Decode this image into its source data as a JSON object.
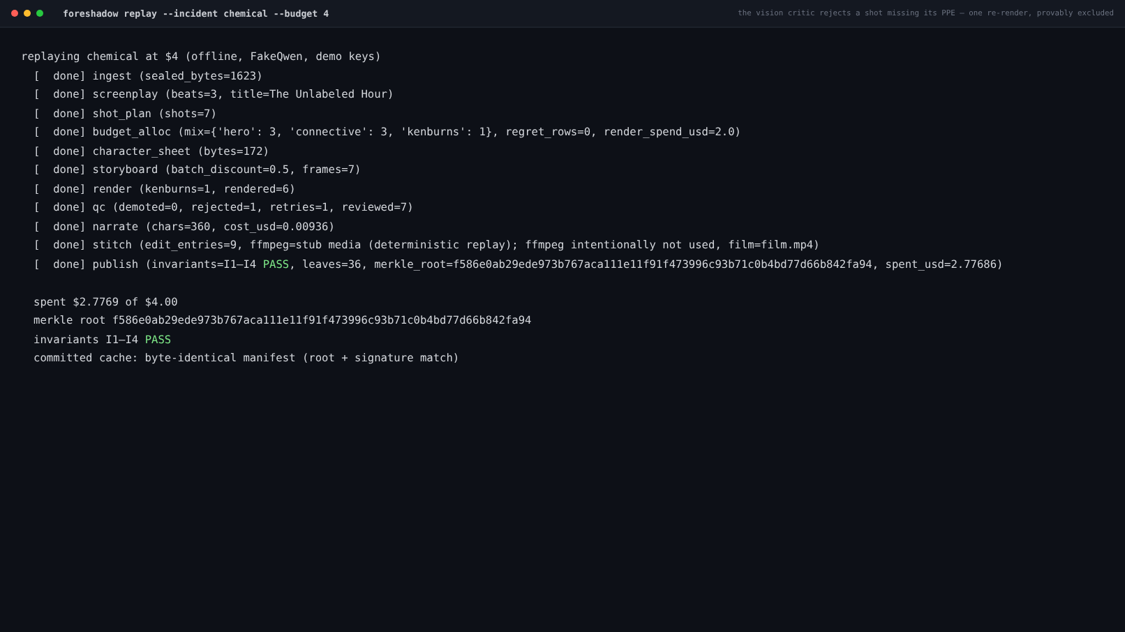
{
  "window": {
    "title": "foreshadow replay --incident chemical --budget 4",
    "subtitle": "the vision critic rejects a shot missing its PPE — one re-render, provably excluded"
  },
  "header": "replaying chemical at $4 (offline, FakeQwen, demo keys)",
  "steps": [
    {
      "status": "[  done]",
      "step": "ingest",
      "detail": [
        {
          "kind": "plain",
          "text": "(sealed_bytes=1623)"
        }
      ]
    },
    {
      "status": "[  done]",
      "step": "screenplay",
      "detail": [
        {
          "kind": "plain",
          "text": "(beats=3, title=The Unlabeled Hour)"
        }
      ]
    },
    {
      "status": "[  done]",
      "step": "shot_plan",
      "detail": [
        {
          "kind": "plain",
          "text": "(shots=7)"
        }
      ]
    },
    {
      "status": "[  done]",
      "step": "budget_alloc",
      "detail": [
        {
          "kind": "plain",
          "text": "(mix={'hero': 3, 'connective': 3, 'kenburns': 1}, regret_rows=0, render_spend_usd=2.0)"
        }
      ]
    },
    {
      "status": "[  done]",
      "step": "character_sheet",
      "detail": [
        {
          "kind": "plain",
          "text": "(bytes=172)"
        }
      ]
    },
    {
      "status": "[  done]",
      "step": "storyboard",
      "detail": [
        {
          "kind": "plain",
          "text": "(batch_discount=0.5, frames=7)"
        }
      ]
    },
    {
      "status": "[  done]",
      "step": "render",
      "detail": [
        {
          "kind": "plain",
          "text": "(kenburns=1, rendered=6)"
        }
      ]
    },
    {
      "status": "[  done]",
      "step": "qc",
      "detail": [
        {
          "kind": "plain",
          "text": "(demoted=0, rejected=1, retries=1, reviewed=7)"
        }
      ]
    },
    {
      "status": "[  done]",
      "step": "narrate",
      "detail": [
        {
          "kind": "plain",
          "text": "(chars=360, cost_usd=0.00936)"
        }
      ]
    },
    {
      "status": "[  done]",
      "step": "stitch",
      "detail": [
        {
          "kind": "plain",
          "text": "(edit_entries=9, ffmpeg=stub media (deterministic replay); ffmpeg intentionally not used, film=film.mp4)"
        }
      ]
    },
    {
      "status": "[  done]",
      "step": "publish",
      "detail": [
        {
          "kind": "plain",
          "text": "(invariants=I1–I4 "
        },
        {
          "kind": "pass",
          "text": "PASS"
        },
        {
          "kind": "plain",
          "text": ", leaves=36, merkle_root=f586e0ab29ede973b767aca111e11f91f473996c93b71c0b4bd77d66b842fa94, spent_usd=2.77686)"
        }
      ]
    }
  ],
  "summary": [
    [
      {
        "kind": "plain",
        "text": "spent $2.7769 of $4.00"
      }
    ],
    [
      {
        "kind": "plain",
        "text": "merkle root f586e0ab29ede973b767aca111e11f91f473996c93b71c0b4bd77d66b842fa94"
      }
    ],
    [
      {
        "kind": "plain",
        "text": "invariants I1–I4 "
      },
      {
        "kind": "pass",
        "text": "PASS"
      }
    ],
    [
      {
        "kind": "plain",
        "text": "committed cache: byte-identical manifest (root + signature match)"
      }
    ]
  ]
}
